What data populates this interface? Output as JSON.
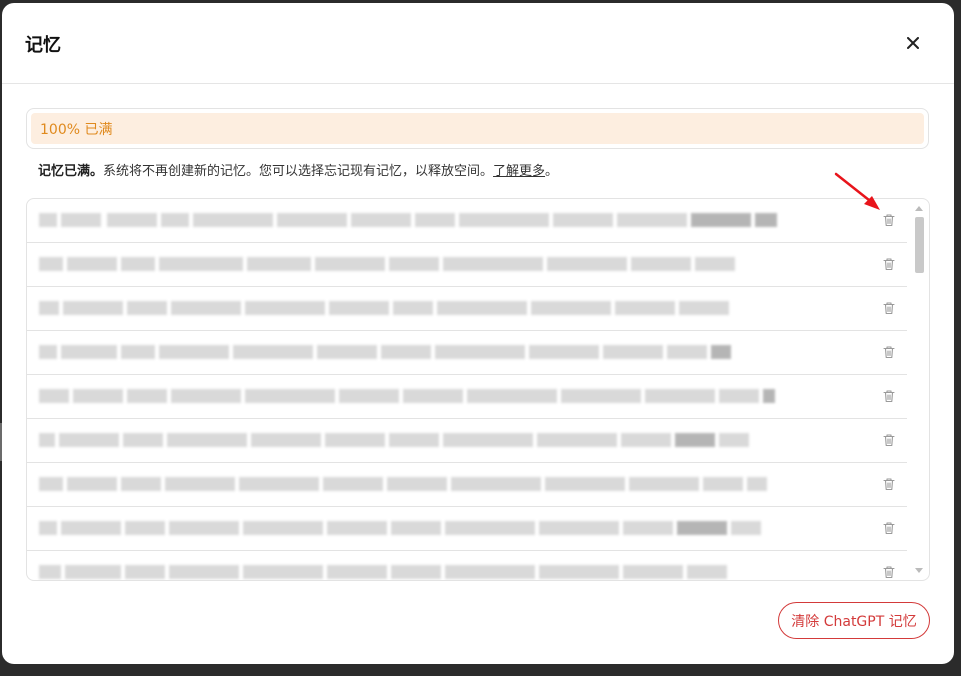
{
  "modal": {
    "title": "记忆",
    "close_icon": "close-icon"
  },
  "usage": {
    "fill_fraction": 1.0,
    "label": "100% 已满",
    "color": "#e08a1e",
    "background": "#fdeee0"
  },
  "notice": {
    "bold": "记忆已满。",
    "text": "系统将不再创建新的记忆。您可以选择忘记现有记忆，以释放空间。",
    "link": "了解更多",
    "end": "。"
  },
  "memories": {
    "row_count": 9,
    "delete_icon": "trash-icon",
    "content": "blurred"
  },
  "footer": {
    "clear_button": "清除 ChatGPT 记忆",
    "accent": "#d33a3a"
  },
  "annotation": {
    "arrow_color": "#e8141b"
  }
}
